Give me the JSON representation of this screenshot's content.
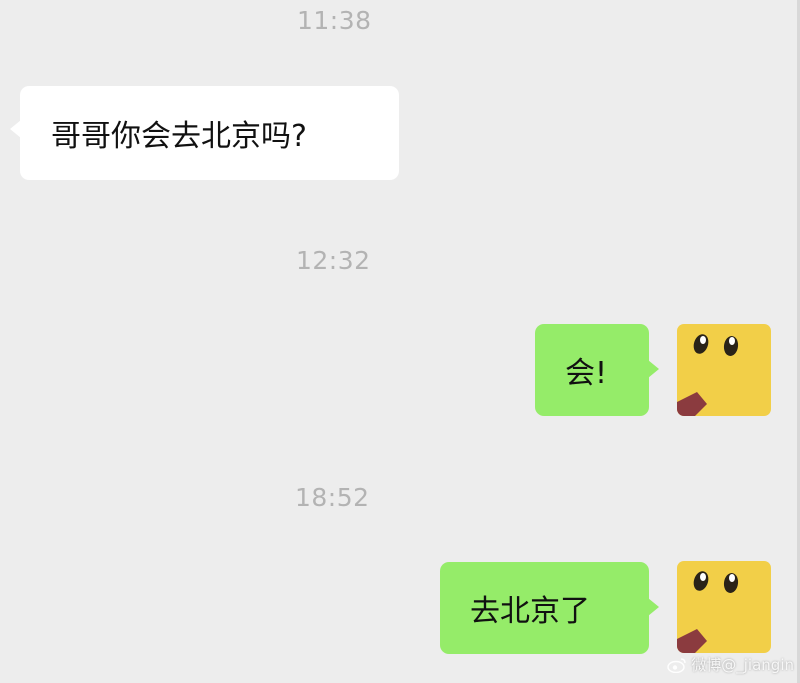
{
  "chat": {
    "messages": [
      {
        "time": "11:38",
        "sender": "contact",
        "text": "哥哥你会去北京吗?"
      },
      {
        "time": "12:32",
        "sender": "me",
        "text": "会!"
      },
      {
        "time": "18:52",
        "sender": "me",
        "text": "去北京了"
      }
    ]
  },
  "colors": {
    "background": "#ededed",
    "incoming_bubble": "#ffffff",
    "outgoing_bubble": "#95ec69",
    "timestamp_text": "#b3b3b3",
    "avatar_yellow": "#f2cf48"
  },
  "avatar": {
    "icon": "pikachu-face-icon"
  },
  "watermark": {
    "icon": "weibo-logo-icon",
    "text": "微博@_jiangin"
  }
}
